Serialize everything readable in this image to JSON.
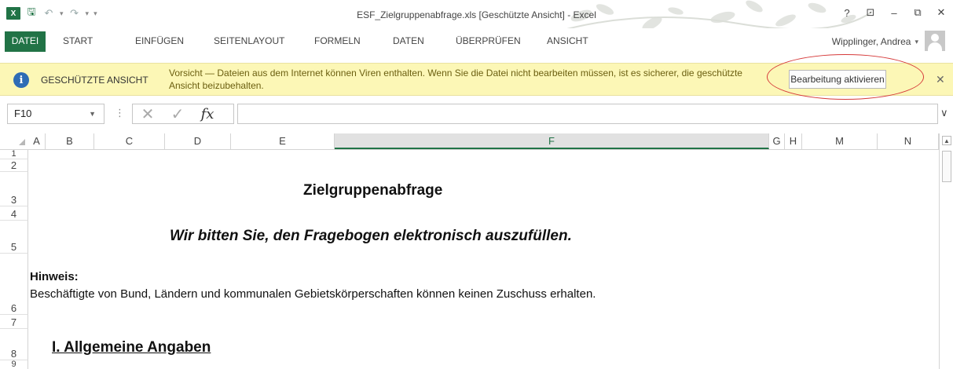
{
  "window": {
    "title": "ESF_Zielgruppenabfrage.xls  [Geschützte Ansicht] - Excel",
    "app_icon": "X",
    "controls": {
      "help": "?",
      "ribbon_options": "⊡",
      "minimize": "–",
      "restore": "⧉",
      "close": "✕"
    }
  },
  "qat": {
    "save": "🖫",
    "undo": "↶",
    "redo": "↷",
    "customize": "▾"
  },
  "ribbon": {
    "tabs": [
      "DATEI",
      "START",
      "EINFÜGEN",
      "SEITENLAYOUT",
      "FORMELN",
      "DATEN",
      "ÜBERPRÜFEN",
      "ANSICHT"
    ],
    "user": "Wipplinger, Andrea",
    "accent": "#217346"
  },
  "protected_view": {
    "title": "GESCHÜTZTE ANSICHT",
    "message": "Vorsicht — Dateien aus dem Internet können Viren enthalten. Wenn Sie die Datei nicht bearbeiten müssen, ist es sicherer, die geschützte Ansicht beizubehalten.",
    "button": "Bearbeitung aktivieren",
    "close": "✕",
    "icon": "i",
    "background": "#fcf7b6",
    "highlight_color": "#d63a3a"
  },
  "formula_bar": {
    "name_box": "F10",
    "cancel": "✕",
    "enter": "✓",
    "function": "fx",
    "formula": ""
  },
  "columns": [
    "A",
    "B",
    "C",
    "D",
    "E",
    "F",
    "G",
    "H",
    "M",
    "N"
  ],
  "selected_column": "F",
  "rows": [
    "1",
    "2",
    "3",
    "4",
    "5",
    "6",
    "7",
    "8",
    "9"
  ],
  "cells": {
    "title": "Zielgruppenabfrage",
    "subtitle": "Wir bitten Sie, den Fragebogen elektronisch auszufüllen.",
    "hint_label": "Hinweis:",
    "hint_text": "Beschäftigte von Bund, Ländern und kommunalen Gebietskörperschaften können keinen Zuschuss erhalten.",
    "section_1": "I. Allgemeine Angaben"
  }
}
